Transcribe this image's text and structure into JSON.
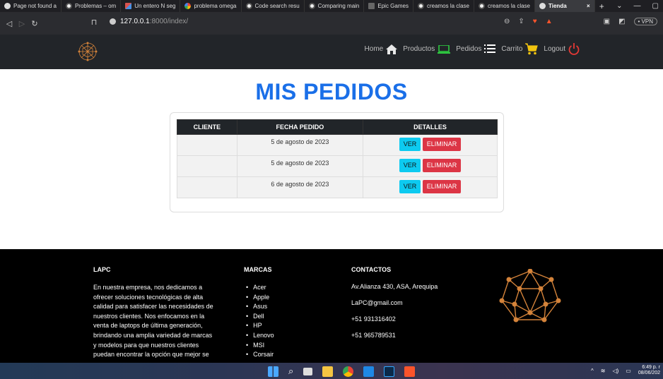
{
  "browser": {
    "tabs": [
      {
        "label": "Page not found a",
        "active": false
      },
      {
        "label": "Problemas – om",
        "active": false
      },
      {
        "label": "Un entero N seg",
        "active": false
      },
      {
        "label": "problema omega",
        "active": false
      },
      {
        "label": "Code search resu",
        "active": false
      },
      {
        "label": "Comparing main",
        "active": false
      },
      {
        "label": "Epic Games",
        "active": false
      },
      {
        "label": "creamos la clase",
        "active": false
      },
      {
        "label": "creamos la clase",
        "active": false
      },
      {
        "label": "Tienda",
        "active": true
      }
    ],
    "new_tab": "+",
    "close_tab": "×",
    "url_host": "127.0.0.1",
    "url_path": ":8000/index/",
    "vpn_label": "• VPN"
  },
  "navbar": {
    "items": [
      {
        "label": "Home",
        "icon": "home-icon"
      },
      {
        "label": "Productos",
        "icon": "laptop-icon"
      },
      {
        "label": "Pedidos",
        "icon": "list-icon"
      },
      {
        "label": "Carrito",
        "icon": "cart-icon"
      },
      {
        "label": "Logout",
        "icon": "power-icon"
      }
    ]
  },
  "page": {
    "title": "MIS PEDIDOS"
  },
  "orders": {
    "headers": [
      "CLIENTE",
      "FECHA PEDIDO",
      "DETALLES"
    ],
    "rows": [
      {
        "cliente": "",
        "fecha": "5 de agosto de 2023"
      },
      {
        "cliente": "",
        "fecha": "5 de agosto de 2023"
      },
      {
        "cliente": "",
        "fecha": "6 de agosto de 2023"
      }
    ],
    "ver_label": "VER",
    "eliminar_label": "ELIMINAR"
  },
  "footer": {
    "col1_title": "LAPC",
    "col1_text": "En nuestra empresa, nos dedicamos a ofrecer soluciones tecnológicas de alta calidad para satisfacer las necesidades de nuestros clientes. Nos enfocamos en la venta de laptops de última generación, brindando una amplia variedad de marcas y modelos para que nuestros clientes puedan encontrar la opción que mejor se",
    "col2_title": "MARCAS",
    "brands": [
      "Acer",
      "Apple",
      "Asus",
      "Dell",
      "HP",
      "Lenovo",
      "MSI",
      "Corsair"
    ],
    "col3_title": "CONTACTOS",
    "contacts": [
      "Av.Alianza 430, ASA, Arequipa",
      "LaPC@gmail.com",
      "+51 931316402",
      "+51 965789531"
    ]
  },
  "taskbar": {
    "time": "6:49 p. r",
    "date": "08/06/202"
  },
  "colors": {
    "title_blue": "#1a6fe8",
    "ver_button": "#0dcaf0",
    "eliminar_button": "#dc3545",
    "navbar_bg": "#222529",
    "footer_bg": "#000000"
  }
}
